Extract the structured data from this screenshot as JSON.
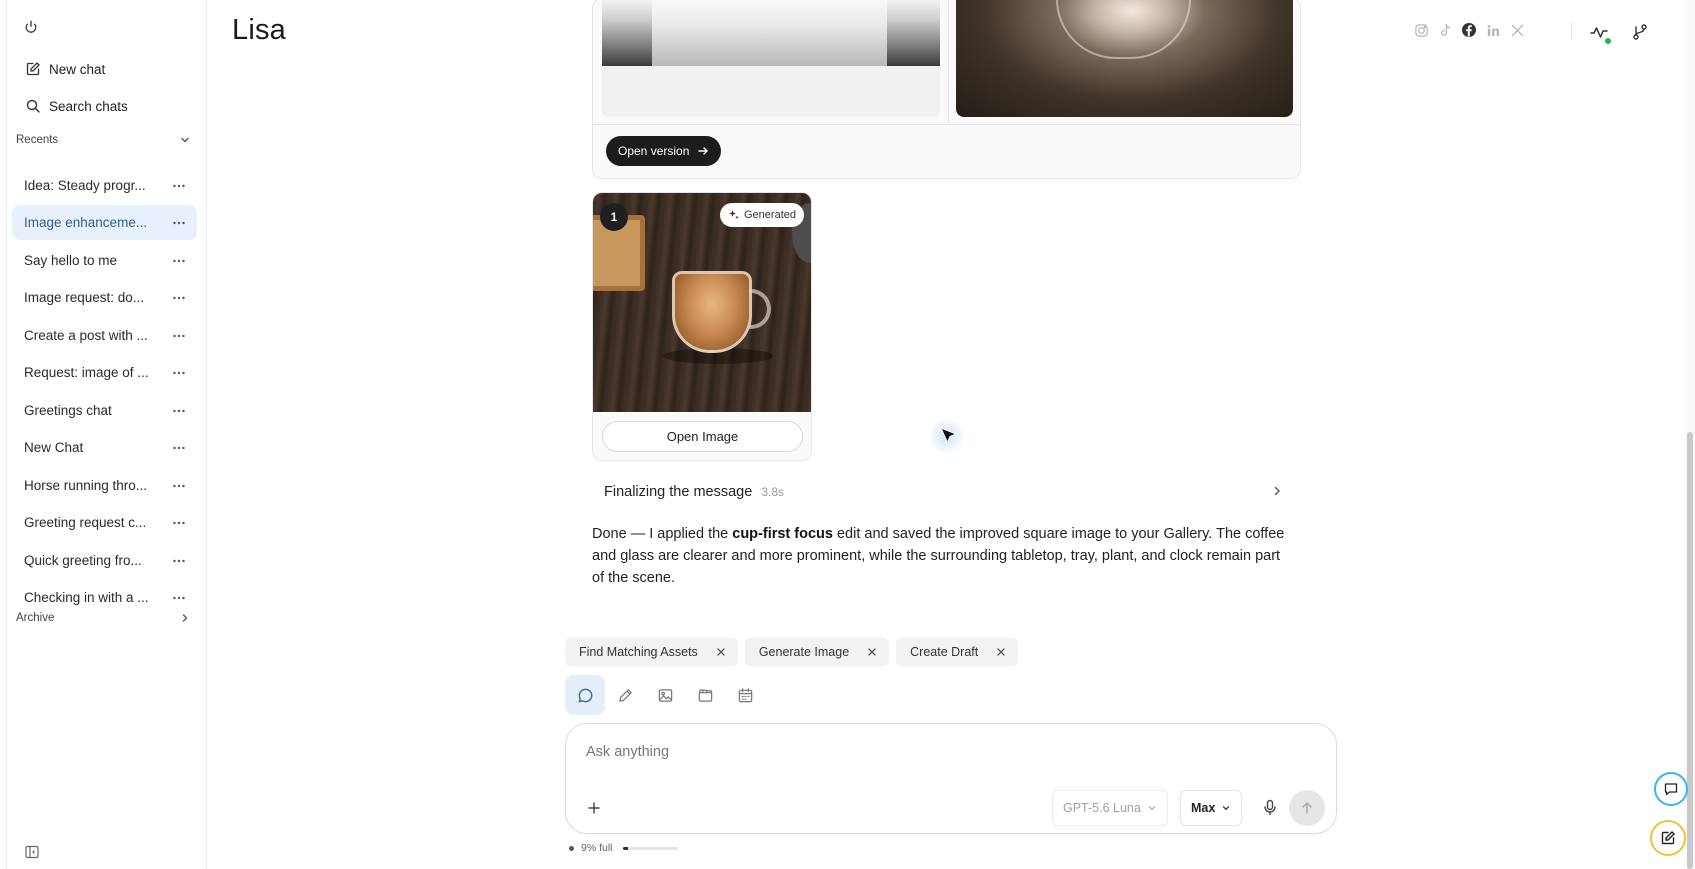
{
  "app": {
    "page_title": "Lisa"
  },
  "sidebar": {
    "new_chat_label": "New chat",
    "search_label": "Search chats",
    "recents_label": "Recents",
    "archive_label": "Archive",
    "items": [
      {
        "label": "Idea: Steady progr..."
      },
      {
        "label": "Image enhanceme..."
      },
      {
        "label": "Say hello to me"
      },
      {
        "label": "Image request: do..."
      },
      {
        "label": "Create a post with ..."
      },
      {
        "label": "Request: image of ..."
      },
      {
        "label": "Greetings chat"
      },
      {
        "label": "New Chat"
      },
      {
        "label": "Horse running thro..."
      },
      {
        "label": "Greeting request c..."
      },
      {
        "label": "Quick greeting fro..."
      },
      {
        "label": "Checking in with a ..."
      }
    ],
    "active_index": 1
  },
  "header": {
    "social_icons": [
      "instagram-icon",
      "tiktok-icon",
      "facebook-icon",
      "linkedin-icon",
      "x-icon"
    ],
    "status_color": "#1db954"
  },
  "version_card": {
    "open_version_label": "Open version"
  },
  "image_card": {
    "index_badge": "1",
    "generated_label": "Generated",
    "open_image_label": "Open Image"
  },
  "status": {
    "finalizing_label": "Finalizing the message",
    "finalizing_time": "3.8s"
  },
  "message": {
    "part1": "Done — I applied the ",
    "bold": "cup-first focus",
    "part2": " edit and saved the improved square image to your Gallery. The coffee and glass are clearer and more prominent, while the surrounding tabletop, tray, plant, and clock remain part of the scene."
  },
  "chips": [
    {
      "label": "Find Matching Assets"
    },
    {
      "label": "Generate Image"
    },
    {
      "label": "Create Draft"
    }
  ],
  "modes": [
    "chat-bubble-icon",
    "pen-icon",
    "image-icon",
    "video-icon",
    "calendar-icon"
  ],
  "composer": {
    "placeholder": "Ask anything",
    "model": "GPT-5.6 Luna",
    "effort": "Max"
  },
  "usage": {
    "label": "9% full",
    "fraction": 0.09
  },
  "colors": {
    "accent": "#2c6db5",
    "active_sidebar_bg": "#e8f1fb",
    "chat_fab_ring": "#39b6e6",
    "edit_fab_ring": "#f0c23a"
  }
}
